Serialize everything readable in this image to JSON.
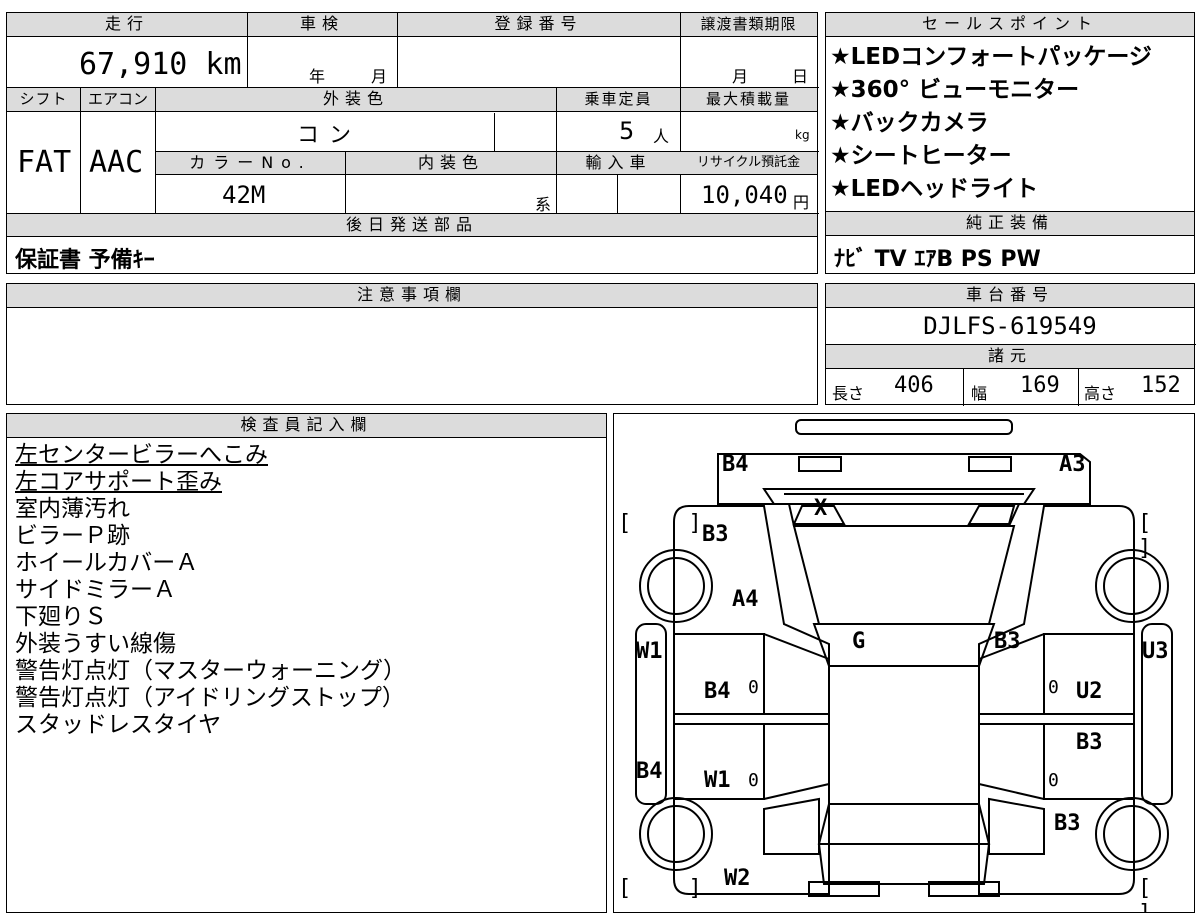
{
  "info_table": {
    "mileage_header": "走行",
    "mileage_value": "67,910 km",
    "shaken_header": "車検",
    "shaken_year_label": "年",
    "shaken_month_label": "月",
    "registration_header": "登録番号",
    "transfer_deadline_header": "譲渡書類期限",
    "transfer_month_label": "月",
    "transfer_day_label": "日",
    "shift_header": "シフト",
    "shift_value": "FAT",
    "ac_header": "エアコン",
    "ac_value": "AAC",
    "exterior_color_header": "外装色",
    "exterior_color_value": "コン",
    "capacity_header": "乗車定員",
    "capacity_value": "5",
    "capacity_unit": "人",
    "max_load_header": "最大積載量",
    "max_load_unit": "kg",
    "color_no_header": "カラーNo.",
    "color_no_value": "42M",
    "interior_color_header": "内装色",
    "interior_color_suffix": "系",
    "import_header": "輸入車",
    "recycle_header": "リサイクル預託金",
    "recycle_value": "10,040",
    "recycle_unit": "円",
    "later_parts_header": "後日発送部品",
    "later_parts_value": "保証書 予備ｷｰ"
  },
  "sales_points": {
    "header": "セールスポイント",
    "items": [
      "★LEDコンフォートパッケージ",
      "★360° ビューモニター",
      "★バックカメラ",
      "★シートヒーター",
      "★LEDヘッドライト"
    ]
  },
  "genuine_equipment": {
    "header": "純正装備",
    "value": "ﾅﾋﾞ TV ｴｱB PS PW"
  },
  "caution": {
    "header": "注意事項欄"
  },
  "chassis": {
    "header": "車台番号",
    "value": "DJLFS-619549"
  },
  "specs": {
    "header": "諸元",
    "length_label": "長さ",
    "length_value": "406",
    "width_label": "幅",
    "width_value": "169",
    "height_label": "高さ",
    "height_value": "152"
  },
  "inspector": {
    "header": "検査員記入欄",
    "notes": [
      "左センタービラーへこみ",
      "左コアサポート歪み",
      "室内薄汚れ",
      "ビラーＰ跡",
      "ホイールカバーＡ",
      "サイドミラーＡ",
      "下廻りＳ",
      "外装うすい線傷",
      "警告灯点灯（マスターウォーニング）",
      "警告灯点灯（アイドリングストップ）",
      "スタッドレスタイヤ"
    ],
    "underlined_count": 2
  },
  "diagram": {
    "labels": {
      "b4_top": "B4",
      "a3": "A3",
      "x": "X",
      "b3_left": "B3",
      "a4": "A4",
      "g": "G",
      "b3_right": "B3",
      "w1_left": "W1",
      "u3": "U3",
      "b4_mid": "B4",
      "u2": "U2",
      "b3_mid": "B3",
      "b4_lower": "B4",
      "w1_mid": "W1",
      "b3_low": "B3",
      "w2": "W2",
      "zero_a": "0",
      "zero_b": "0",
      "zero_c": "0",
      "zero_d": "0"
    },
    "bracket": "[ ]"
  }
}
